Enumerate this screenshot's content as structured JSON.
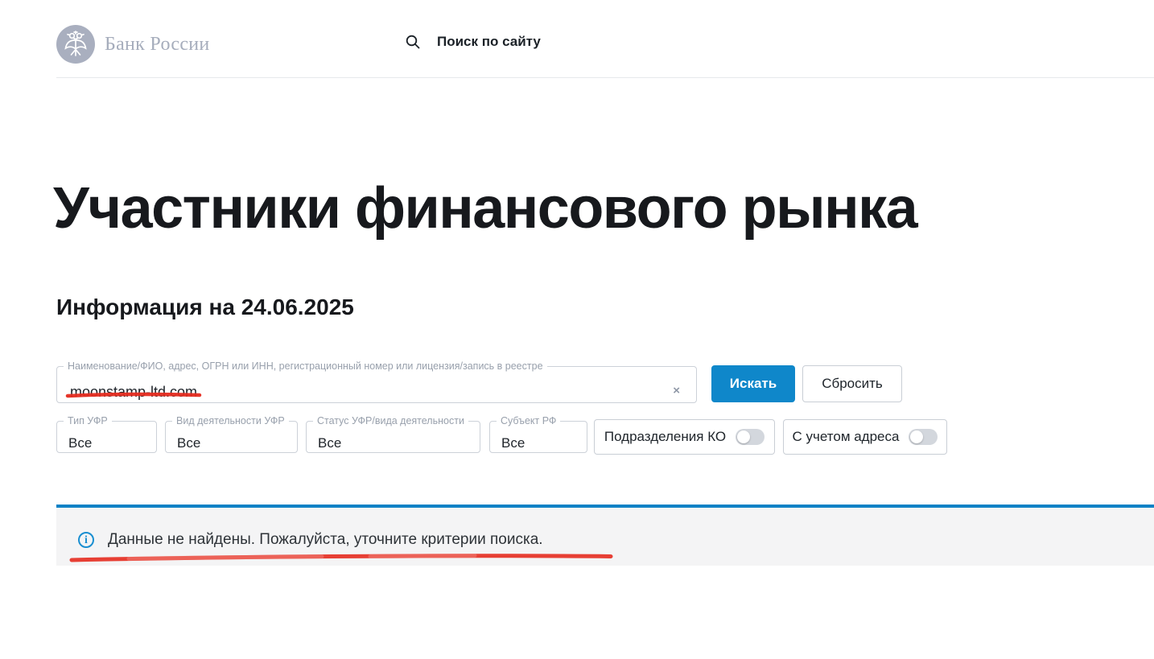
{
  "header": {
    "logo_text": "Банк России",
    "site_search_label": "Поиск по сайту"
  },
  "page": {
    "title": "Участники финансового рынка",
    "subtitle": "Информация на 24.06.2025"
  },
  "search_form": {
    "query_label": "Наименование/ФИО, адрес, ОГРН или ИНН, регистрационный номер или лицензия/запись в реестре",
    "query_value": "moonstamp-ltd.com",
    "search_button": "Искать",
    "reset_button": "Сбросить"
  },
  "filters": [
    {
      "label": "Тип УФР",
      "value": "Все"
    },
    {
      "label": "Вид деятельности УФР",
      "value": "Все"
    },
    {
      "label": "Статус УФР/вида деятельности",
      "value": "Все"
    },
    {
      "label": "Субъект РФ",
      "value": "Все"
    }
  ],
  "toggles": [
    {
      "label": "Подразделения КО",
      "state": "off"
    },
    {
      "label": "С учетом адреса",
      "state": "off"
    }
  ],
  "results": {
    "message": "Данные не найдены. Пожалуйста, уточните критерии поиска."
  },
  "icons": {
    "clear": "×",
    "info": "i"
  },
  "colors": {
    "accent_blue": "#0f87ca",
    "results_bar_blue": "#0e82c6",
    "info_blue": "#1a8fd1",
    "annotation_red": "#e52b1f",
    "logo_gray": "#a9afbf",
    "border_gray": "#ccd1d8",
    "label_gray": "#98a0ac",
    "text_dark": "#1f242a"
  }
}
